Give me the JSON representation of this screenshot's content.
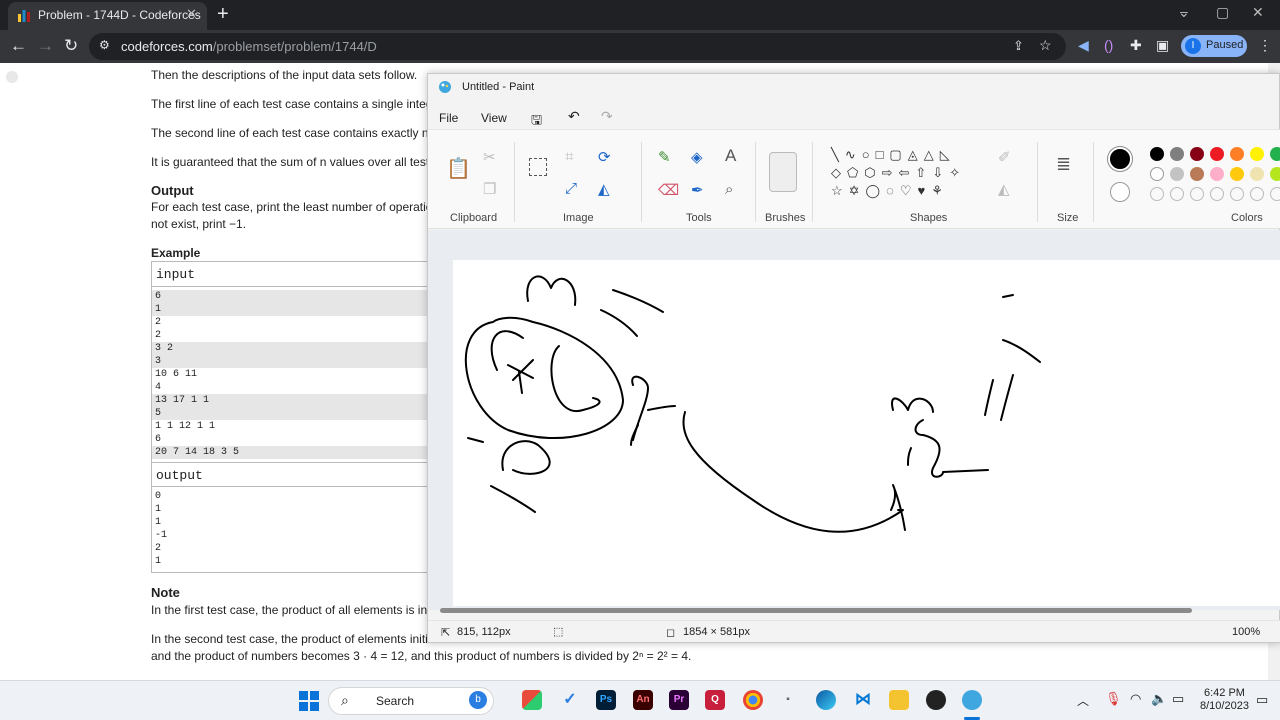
{
  "browser": {
    "tab_title": "Problem - 1744D - Codeforces",
    "url_host": "codeforces.com",
    "url_path": "/problemset/problem/1744/D",
    "profile_initial": "I",
    "profile_status": "Paused"
  },
  "problem": {
    "para1": "Then the descriptions of the input data sets follow.",
    "para2": "The first line of each test case contains a single intege",
    "para3": "The second line of each test case contains exactly n",
    "para4": "It is guaranteed that the sum of n values over all test",
    "output_heading": "Output",
    "output_text1": "For each test case, print the least number of operation",
    "output_text2": "not exist, print −1.",
    "example_heading": "Example",
    "input_label": "input",
    "input_lines": [
      "6",
      "1",
      "2",
      "2",
      "3 2",
      "3",
      "10 6 11",
      "4",
      "13 17 1 1",
      "5",
      "1 1 12 1 1",
      "6",
      "20 7 14 18 3 5"
    ],
    "output_label": "output",
    "output_lines": [
      "0",
      "1",
      "1",
      "-1",
      "2",
      "1"
    ],
    "note_heading": "Note",
    "note1": "In the first test case, the product of all elements is initi",
    "note2": "In the second test case, the product of elements initia",
    "note3": "and the product of numbers becomes 3 · 4 = 12, and this product of numbers is divided by 2ⁿ = 2² = 4."
  },
  "paint": {
    "title": "Untitled - Paint",
    "menu_file": "File",
    "menu_view": "View",
    "groups": {
      "clipboard": "Clipboard",
      "image": "Image",
      "tools": "Tools",
      "brushes": "Brushes",
      "shapes": "Shapes",
      "size": "Size",
      "colors": "Colors"
    },
    "status_cursor": "815, 112px",
    "status_size": "1854 × 581px",
    "status_zoom": "100%",
    "palette_row1": [
      "#000000",
      "#7f7f7f",
      "#880015",
      "#ed1c24",
      "#ff7f27",
      "#fff200",
      "#22b14c"
    ],
    "palette_row2": [
      "#ffffff",
      "#c3c3c3",
      "#b97a57",
      "#ffaec9",
      "#ffc90e",
      "#efe4b0",
      "#b5e61d"
    ]
  },
  "taskbar": {
    "search_placeholder": "Search",
    "time": "6:42 PM",
    "date": "8/10/2023"
  }
}
